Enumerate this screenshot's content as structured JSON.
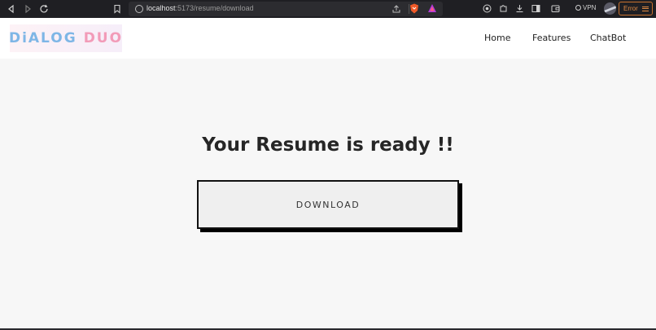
{
  "browser": {
    "url_host": "localhost",
    "url_path": ":5173/resume/download",
    "vpn_label": "VPN",
    "error_label": "Error"
  },
  "header": {
    "logo_word1": "DiALOG",
    "logo_word2": "DUO",
    "nav": [
      {
        "label": "Home"
      },
      {
        "label": "Features"
      },
      {
        "label": "ChatBot"
      }
    ]
  },
  "main": {
    "heading": "Your Resume is ready !!",
    "download_label": "DOWNLOAD"
  },
  "colors": {
    "logo_blue": "#7eb6e6",
    "logo_pink": "#f29bb8",
    "error_orange": "#e08a42"
  }
}
